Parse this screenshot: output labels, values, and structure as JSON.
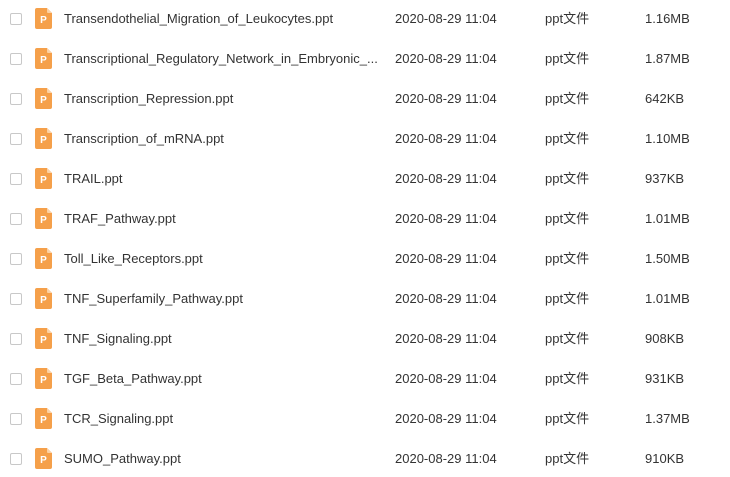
{
  "colors": {
    "icon_fill": "#f5a04a",
    "icon_fold": "#fbd2a6",
    "text": "#333333",
    "checkbox_border": "#c8c8c8"
  },
  "icon_name": "ppt-file-icon",
  "icon_letter": "P",
  "files": [
    {
      "name": "Transendothelial_Migration_of_Leukocytes.ppt",
      "date": "2020-08-29 11:04",
      "type": "ppt文件",
      "size": "1.16MB"
    },
    {
      "name": "Transcriptional_Regulatory_Network_in_Embryonic_...",
      "date": "2020-08-29 11:04",
      "type": "ppt文件",
      "size": "1.87MB"
    },
    {
      "name": "Transcription_Repression.ppt",
      "date": "2020-08-29 11:04",
      "type": "ppt文件",
      "size": "642KB"
    },
    {
      "name": "Transcription_of_mRNA.ppt",
      "date": "2020-08-29 11:04",
      "type": "ppt文件",
      "size": "1.10MB"
    },
    {
      "name": "TRAIL.ppt",
      "date": "2020-08-29 11:04",
      "type": "ppt文件",
      "size": "937KB"
    },
    {
      "name": "TRAF_Pathway.ppt",
      "date": "2020-08-29 11:04",
      "type": "ppt文件",
      "size": "1.01MB"
    },
    {
      "name": "Toll_Like_Receptors.ppt",
      "date": "2020-08-29 11:04",
      "type": "ppt文件",
      "size": "1.50MB"
    },
    {
      "name": "TNF_Superfamily_Pathway.ppt",
      "date": "2020-08-29 11:04",
      "type": "ppt文件",
      "size": "1.01MB"
    },
    {
      "name": "TNF_Signaling.ppt",
      "date": "2020-08-29 11:04",
      "type": "ppt文件",
      "size": "908KB"
    },
    {
      "name": "TGF_Beta_Pathway.ppt",
      "date": "2020-08-29 11:04",
      "type": "ppt文件",
      "size": "931KB"
    },
    {
      "name": "TCR_Signaling.ppt",
      "date": "2020-08-29 11:04",
      "type": "ppt文件",
      "size": "1.37MB"
    },
    {
      "name": "SUMO_Pathway.ppt",
      "date": "2020-08-29 11:04",
      "type": "ppt文件",
      "size": "910KB"
    }
  ]
}
